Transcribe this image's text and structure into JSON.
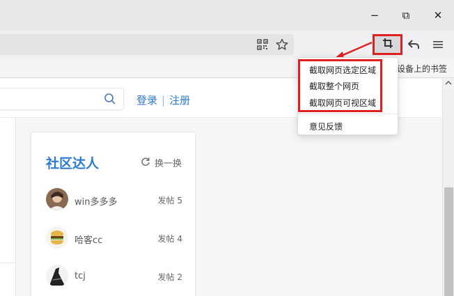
{
  "window": {
    "controls": {
      "minimize": "−",
      "maximize": "⧉",
      "close": "✕"
    }
  },
  "toolbar": {
    "icons": [
      "qr-code-icon",
      "star-icon",
      "crop-icon",
      "undo-icon",
      "menu-icon"
    ]
  },
  "bookmarks": {
    "label": "设备上的书签"
  },
  "site": {
    "login": "登录",
    "separator": "|",
    "register": "注册"
  },
  "community": {
    "title": "社区达人",
    "refresh_label": "换一换",
    "users": [
      {
        "name": "win多多多",
        "posts": "发帖 5"
      },
      {
        "name": "哈客cc",
        "posts": "发帖 4"
      },
      {
        "name": "tcj",
        "posts": "发帖 2"
      }
    ]
  },
  "screenshot_menu": {
    "items": [
      "截取网页选定区域",
      "截取整个网页",
      "截取网页可视区域"
    ],
    "feedback": "意见反馈"
  },
  "colors": {
    "accent": "#2b7bd1",
    "annotation_red": "#e02020"
  }
}
